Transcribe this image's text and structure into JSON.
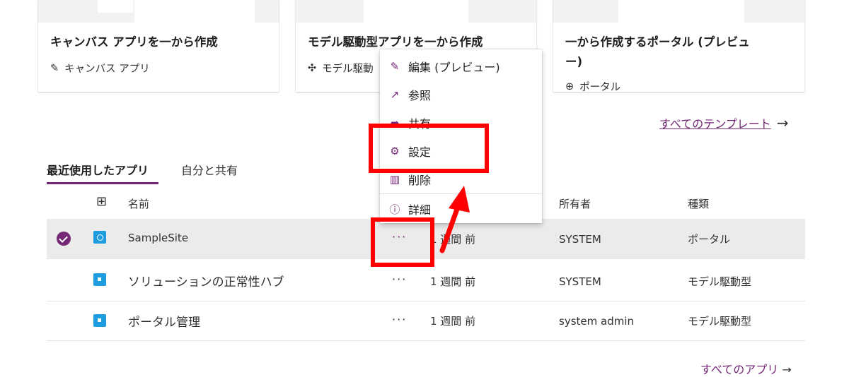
{
  "templates": [
    {
      "title": "キャンバス アプリを一から作成",
      "subtitle": "キャンバス アプリ",
      "icon": "pencil-icon"
    },
    {
      "title": "モデル駆動型アプリを一から作成",
      "subtitle": "モデル駆動",
      "icon": "puzzle-icon"
    },
    {
      "title_line1": "一から作成するポータル (プレビュ",
      "title_line2": "ー)",
      "subtitle": "ポータル",
      "icon": "globe-icon"
    }
  ],
  "all_templates_label": "すべてのテンプレート",
  "tabs": {
    "recent": "最近使用したアプリ",
    "shared": "自分と共有"
  },
  "table": {
    "headers": {
      "name": "名前",
      "owner": "所有者",
      "type": "種類"
    },
    "more_label": "···",
    "rows": [
      {
        "name": "SampleSite",
        "modified": "1 週間 前",
        "owner": "SYSTEM",
        "type": "ポータル",
        "selected": true
      },
      {
        "name": "ソリューションの正常性ハブ",
        "modified": "1 週間 前",
        "owner": "SYSTEM",
        "type": "モデル駆動型",
        "selected": false
      },
      {
        "name": "ポータル管理",
        "modified": "1 週間 前",
        "owner": "system admin",
        "type": "モデル駆動型",
        "selected": false
      }
    ]
  },
  "context_menu": {
    "items": [
      {
        "label": "編集 (プレビュー)",
        "icon": "pencil-icon"
      },
      {
        "label": "参照",
        "icon": "open-external-icon"
      },
      {
        "label": "共有",
        "icon": "share-icon"
      },
      {
        "label": "設定",
        "icon": "gear-icon"
      },
      {
        "label": "削除",
        "icon": "trash-icon"
      },
      {
        "label": "詳細",
        "icon": "info-icon"
      }
    ]
  },
  "footer_link": "すべてのアプリ",
  "colors": {
    "accent": "#742774",
    "highlight": "#ff0000",
    "app_icon": "#1f9ce0"
  }
}
